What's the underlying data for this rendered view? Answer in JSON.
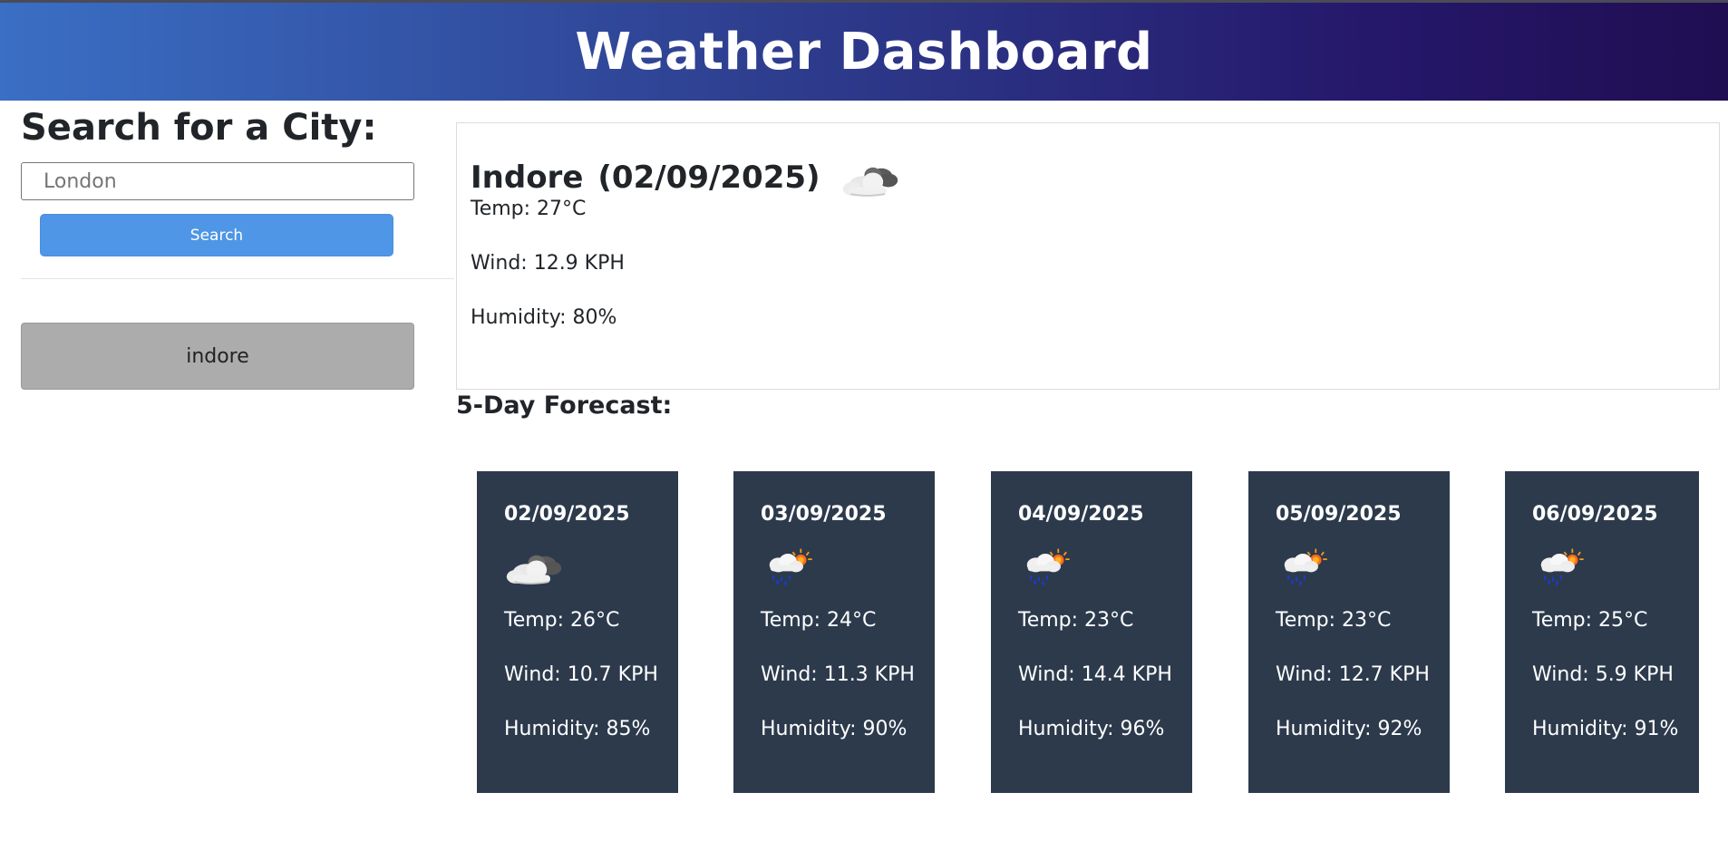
{
  "header": {
    "title": "Weather Dashboard"
  },
  "search": {
    "heading": "Search for a City:",
    "input_value": "",
    "placeholder": "London",
    "button_label": "Search"
  },
  "history": [
    "indore"
  ],
  "current": {
    "city": "Indore",
    "date": "(02/09/2025)",
    "icon": "cloudy-icon",
    "temp": "Temp: 27°C",
    "wind": "Wind: 12.9 KPH",
    "humidity": "Humidity: 80%"
  },
  "forecast": {
    "heading": "5-Day Forecast:",
    "days": [
      {
        "date": "02/09/2025",
        "icon": "cloudy-icon",
        "temp": "Temp: 26°C",
        "wind": "Wind: 10.7 KPH",
        "humidity": "Humidity: 85%"
      },
      {
        "date": "03/09/2025",
        "icon": "rain-sun-icon",
        "temp": "Temp: 24°C",
        "wind": "Wind: 11.3 KPH",
        "humidity": "Humidity: 90%"
      },
      {
        "date": "04/09/2025",
        "icon": "rain-sun-icon",
        "temp": "Temp: 23°C",
        "wind": "Wind: 14.4 KPH",
        "humidity": "Humidity: 96%"
      },
      {
        "date": "05/09/2025",
        "icon": "rain-sun-icon",
        "temp": "Temp: 23°C",
        "wind": "Wind: 12.7 KPH",
        "humidity": "Humidity: 92%"
      },
      {
        "date": "06/09/2025",
        "icon": "rain-sun-icon",
        "temp": "Temp: 25°C",
        "wind": "Wind: 5.9 KPH",
        "humidity": "Humidity: 91%"
      }
    ]
  },
  "colors": {
    "header_gradient_start": "#3a6fc4",
    "header_gradient_end": "#200e52",
    "search_button": "#4f96e6",
    "history_button": "#acacac",
    "forecast_card": "#2c3a4c"
  }
}
